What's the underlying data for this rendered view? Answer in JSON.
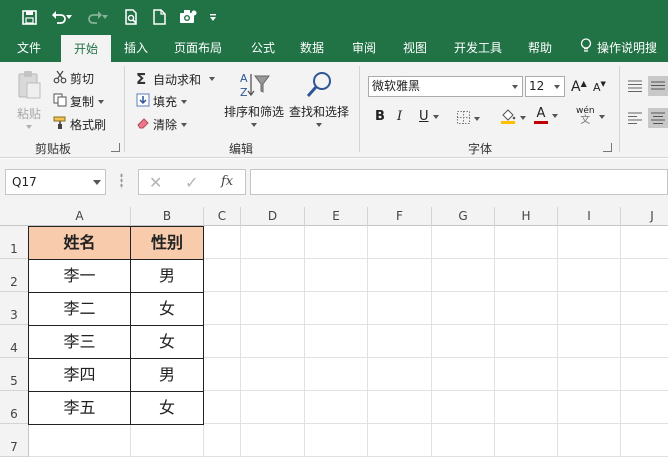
{
  "colors": {
    "brand": "#217346",
    "ribbon_bg": "#f3f3f3",
    "header_fill": "#f8cbad"
  },
  "quick_access": {
    "icons": [
      "save-icon",
      "undo-icon",
      "redo-icon",
      "print-preview-icon",
      "new-file-icon",
      "camera-icon",
      "customize-icon"
    ]
  },
  "tabs": [
    "文件",
    "开始",
    "插入",
    "页面布局",
    "公式",
    "数据",
    "审阅",
    "视图",
    "开发工具",
    "帮助"
  ],
  "active_tab": "开始",
  "tell_me": "操作说明搜",
  "clipboard": {
    "paste": "粘贴",
    "cut": "剪切",
    "copy": "复制",
    "format_painter": "格式刷",
    "label": "剪贴板"
  },
  "editing": {
    "autosum": "自动求和",
    "fill": "填充",
    "clear": "清除",
    "sort_filter": "排序和筛选",
    "find_select": "查找和选择",
    "label": "编辑"
  },
  "font": {
    "name": "微软雅黑",
    "size": "12",
    "bold": "B",
    "italic": "I",
    "underline": "U",
    "grow": "A",
    "shrink": "A",
    "phonetic": "wén",
    "label": "字体"
  },
  "formula_bar": {
    "name_box": "Q17",
    "fx": "fx",
    "value": ""
  },
  "columns": [
    "A",
    "B",
    "C",
    "D",
    "E",
    "F",
    "G",
    "H",
    "I",
    "J"
  ],
  "rows": [
    "1",
    "2",
    "3",
    "4",
    "5",
    "6",
    "7"
  ],
  "table": {
    "headers": [
      "姓名",
      "性别"
    ],
    "rows": [
      [
        "李一",
        "男"
      ],
      [
        "李二",
        "女"
      ],
      [
        "李三",
        "女"
      ],
      [
        "李四",
        "男"
      ],
      [
        "李五",
        "女"
      ]
    ]
  }
}
